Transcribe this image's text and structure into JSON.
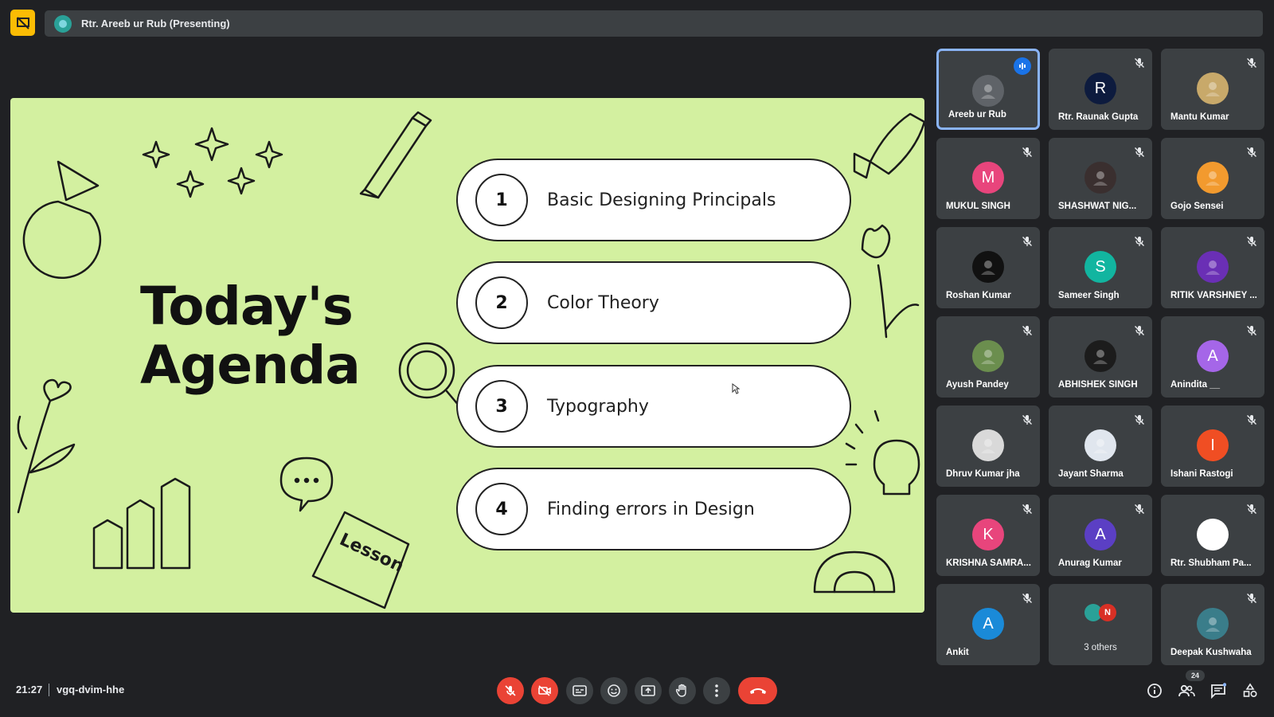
{
  "header": {
    "presenter_label": "Rtr. Areeb ur Rub (Presenting)"
  },
  "slide": {
    "title_line1": "Today's",
    "title_line2": "Agenda",
    "lesson_text": "Lesson",
    "items": [
      {
        "num": "1",
        "label": "Basic Designing Principals"
      },
      {
        "num": "2",
        "label": "Color Theory"
      },
      {
        "num": "3",
        "label": "Typography"
      },
      {
        "num": "4",
        "label": "Finding errors in Design"
      }
    ]
  },
  "participants": [
    {
      "name": "Areeb ur Rub",
      "initial": "",
      "color": "#5f6368",
      "speaking": true
    },
    {
      "name": "Rtr. Raunak Gupta",
      "initial": "R",
      "color": "#0d1b3e"
    },
    {
      "name": "Mantu Kumar",
      "initial": "",
      "color": "#c8a96a"
    },
    {
      "name": "MUKUL SINGH",
      "initial": "M",
      "color": "#e8457c"
    },
    {
      "name": "SHASHWAT NIG...",
      "initial": "",
      "color": "#3a2f2f"
    },
    {
      "name": "Gojo Sensei",
      "initial": "",
      "color": "#f29a2e"
    },
    {
      "name": "Roshan Kumar",
      "initial": "",
      "color": "#111111"
    },
    {
      "name": "Sameer Singh",
      "initial": "S",
      "color": "#12b5a0"
    },
    {
      "name": "RITIK VARSHNEY ...",
      "initial": "",
      "color": "#6a2fb5"
    },
    {
      "name": "Ayush Pandey",
      "initial": "",
      "color": "#6b8e4e"
    },
    {
      "name": "ABHISHEK SINGH",
      "initial": "",
      "color": "#1c1c1c"
    },
    {
      "name": "Anindita __",
      "initial": "A",
      "color": "#a566e8"
    },
    {
      "name": "Dhruv Kumar jha",
      "initial": "",
      "color": "#d9d9d9"
    },
    {
      "name": "Jayant Sharma",
      "initial": "",
      "color": "#e0e6ee"
    },
    {
      "name": "Ishani Rastogi",
      "initial": "I",
      "color": "#f04e23"
    },
    {
      "name": "KRISHNA SAMRA...",
      "initial": "K",
      "color": "#e8457c"
    },
    {
      "name": "Anurag Kumar",
      "initial": "A",
      "color": "#5b3fc4"
    },
    {
      "name": "Rtr. Shubham Pa...",
      "initial": "",
      "color": "#ffffff"
    },
    {
      "name": "Ankit",
      "initial": "A",
      "color": "#1a8ad8"
    },
    {
      "name": "",
      "others": "3 others",
      "initial": "N",
      "color": "#d93025"
    },
    {
      "name": "Deepak Kushwaha",
      "initial": "",
      "color": "#3a7d8a"
    }
  ],
  "footer": {
    "time": "21:27",
    "meeting_code": "vgq-dvim-hhe",
    "people_count": "24"
  },
  "colors": {
    "slide_bg": "#d3f0a0",
    "danger": "#ea4335",
    "accent_blue": "#8ab4f8",
    "tile_bg": "#3c4043"
  }
}
